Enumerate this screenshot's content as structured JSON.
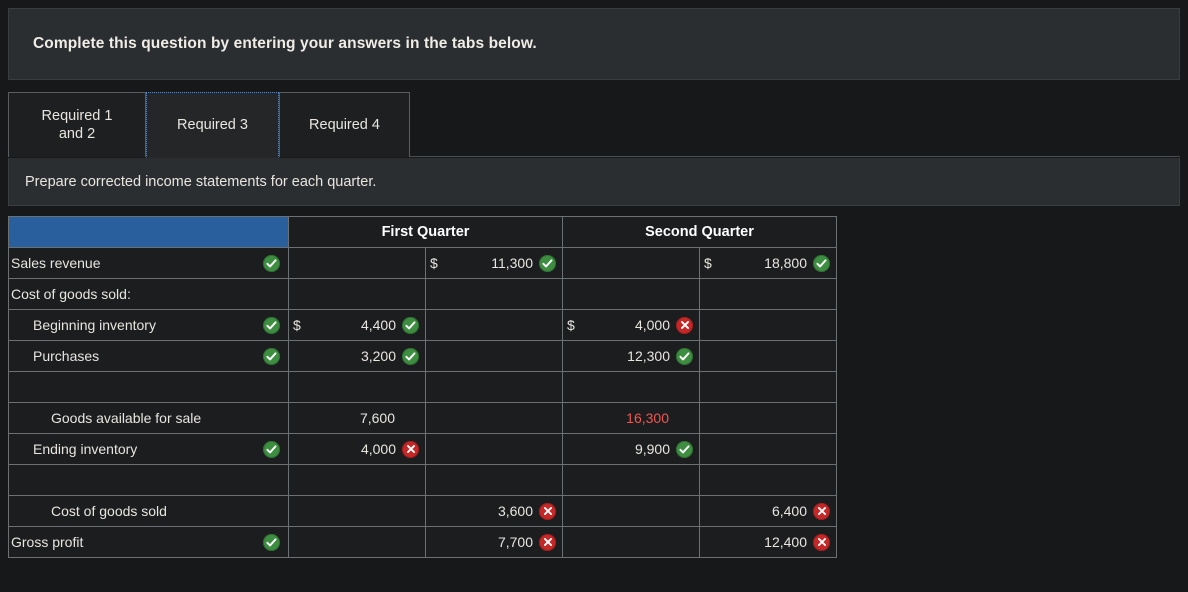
{
  "banner": {
    "text": "Complete this question by entering your answers in the tabs below."
  },
  "tabs": [
    {
      "label": "Required 1\nand 2",
      "active": false
    },
    {
      "label": "Required 3",
      "active": true
    },
    {
      "label": "Required 4",
      "active": false
    }
  ],
  "subbar": {
    "text": "Prepare corrected income statements for each quarter."
  },
  "colors": {
    "header_blue": "#2a5f9e",
    "ok_bg": "#1e2a14",
    "bad_bg": "#3f0d0d",
    "check_green": "#3e8e41",
    "cross_red": "#c62828",
    "error_text_red": "#f4564f",
    "focus_outline": "#4f86c6"
  },
  "table": {
    "headers": {
      "blank": "",
      "q1": "First Quarter",
      "q2": "Second Quarter"
    },
    "rows": [
      {
        "label": "Sales revenue",
        "indent": 0,
        "label_status": "ok",
        "label_icon": "check-icon",
        "q1a": {
          "currency": "",
          "value": "",
          "status": "ok",
          "icon": ""
        },
        "q1b": {
          "currency": "$",
          "value": "11,300",
          "status": "ok",
          "icon": "check-icon"
        },
        "q2a": {
          "currency": "",
          "value": "",
          "status": "ok",
          "icon": ""
        },
        "q2b": {
          "currency": "$",
          "value": "18,800",
          "status": "ok",
          "icon": "check-icon"
        }
      },
      {
        "label": "Cost of goods sold:",
        "indent": 0,
        "label_status": "none",
        "label_icon": "",
        "q1a": {
          "currency": "",
          "value": "",
          "status": "none",
          "icon": ""
        },
        "q1b": {
          "currency": "",
          "value": "",
          "status": "none",
          "icon": ""
        },
        "q2a": {
          "currency": "",
          "value": "",
          "status": "none",
          "icon": ""
        },
        "q2b": {
          "currency": "",
          "value": "",
          "status": "none",
          "icon": ""
        }
      },
      {
        "label": "Beginning inventory",
        "indent": 1,
        "label_status": "ok",
        "label_icon": "check-icon",
        "q1a": {
          "currency": "$",
          "value": "4,400",
          "status": "ok",
          "icon": "check-icon"
        },
        "q1b": {
          "currency": "",
          "value": "",
          "status": "none",
          "icon": ""
        },
        "q2a": {
          "currency": "$",
          "value": "4,000",
          "status": "bad",
          "icon": "cross-icon"
        },
        "q2b": {
          "currency": "",
          "value": "",
          "status": "none",
          "icon": ""
        }
      },
      {
        "label": "Purchases",
        "indent": 1,
        "label_status": "ok",
        "label_icon": "check-icon",
        "q1a": {
          "currency": "",
          "value": "3,200",
          "status": "ok",
          "icon": "check-icon"
        },
        "q1b": {
          "currency": "",
          "value": "",
          "status": "none",
          "icon": ""
        },
        "q2a": {
          "currency": "",
          "value": "12,300",
          "status": "ok",
          "icon": "check-icon"
        },
        "q2b": {
          "currency": "",
          "value": "",
          "status": "none",
          "icon": ""
        }
      },
      {
        "label": "",
        "indent": 0,
        "label_status": "none",
        "label_icon": "",
        "q1a": {
          "currency": "",
          "value": "",
          "status": "none",
          "icon": ""
        },
        "q1b": {
          "currency": "",
          "value": "",
          "status": "none",
          "icon": ""
        },
        "q2a": {
          "currency": "",
          "value": "",
          "status": "none",
          "icon": ""
        },
        "q2b": {
          "currency": "",
          "value": "",
          "status": "none",
          "icon": ""
        }
      },
      {
        "label": "Goods available for sale",
        "indent": 2,
        "label_status": "none",
        "label_icon": "",
        "q1a": {
          "currency": "",
          "value": "7,600",
          "status": "none",
          "icon": "",
          "text_style": "normal"
        },
        "q1b": {
          "currency": "",
          "value": "",
          "status": "none",
          "icon": ""
        },
        "q2a": {
          "currency": "",
          "value": "16,300",
          "status": "none",
          "icon": "",
          "text_style": "error"
        },
        "q2b": {
          "currency": "",
          "value": "",
          "status": "none",
          "icon": ""
        }
      },
      {
        "label": "Ending inventory",
        "indent": 1,
        "label_status": "ok",
        "label_icon": "check-icon",
        "q1a": {
          "currency": "",
          "value": "4,000",
          "status": "bad",
          "icon": "cross-icon"
        },
        "q1b": {
          "currency": "",
          "value": "",
          "status": "none",
          "icon": ""
        },
        "q2a": {
          "currency": "",
          "value": "9,900",
          "status": "ok",
          "icon": "check-icon"
        },
        "q2b": {
          "currency": "",
          "value": "",
          "status": "none",
          "icon": ""
        }
      },
      {
        "label": "",
        "indent": 0,
        "label_status": "none",
        "label_icon": "",
        "q1a": {
          "currency": "",
          "value": "",
          "status": "none",
          "icon": ""
        },
        "q1b": {
          "currency": "",
          "value": "",
          "status": "none",
          "icon": ""
        },
        "q2a": {
          "currency": "",
          "value": "",
          "status": "none",
          "icon": ""
        },
        "q2b": {
          "currency": "",
          "value": "",
          "status": "none",
          "icon": ""
        }
      },
      {
        "label": "Cost of goods sold",
        "indent": 2,
        "label_status": "none",
        "label_icon": "",
        "q1a": {
          "currency": "",
          "value": "",
          "status": "none",
          "icon": ""
        },
        "q1b": {
          "currency": "",
          "value": "3,600",
          "status": "bad",
          "icon": "cross-icon"
        },
        "q2a": {
          "currency": "",
          "value": "",
          "status": "none",
          "icon": ""
        },
        "q2b": {
          "currency": "",
          "value": "6,400",
          "status": "bad",
          "icon": "cross-icon"
        }
      },
      {
        "label": "Gross profit",
        "indent": 0,
        "label_status": "ok",
        "label_icon": "check-icon",
        "q1a": {
          "currency": "",
          "value": "",
          "status": "none",
          "icon": ""
        },
        "q1b": {
          "currency": "",
          "value": "7,700",
          "status": "bad",
          "icon": "cross-icon"
        },
        "q2a": {
          "currency": "",
          "value": "",
          "status": "none",
          "icon": ""
        },
        "q2b": {
          "currency": "",
          "value": "12,400",
          "status": "bad",
          "icon": "cross-icon"
        }
      }
    ]
  }
}
